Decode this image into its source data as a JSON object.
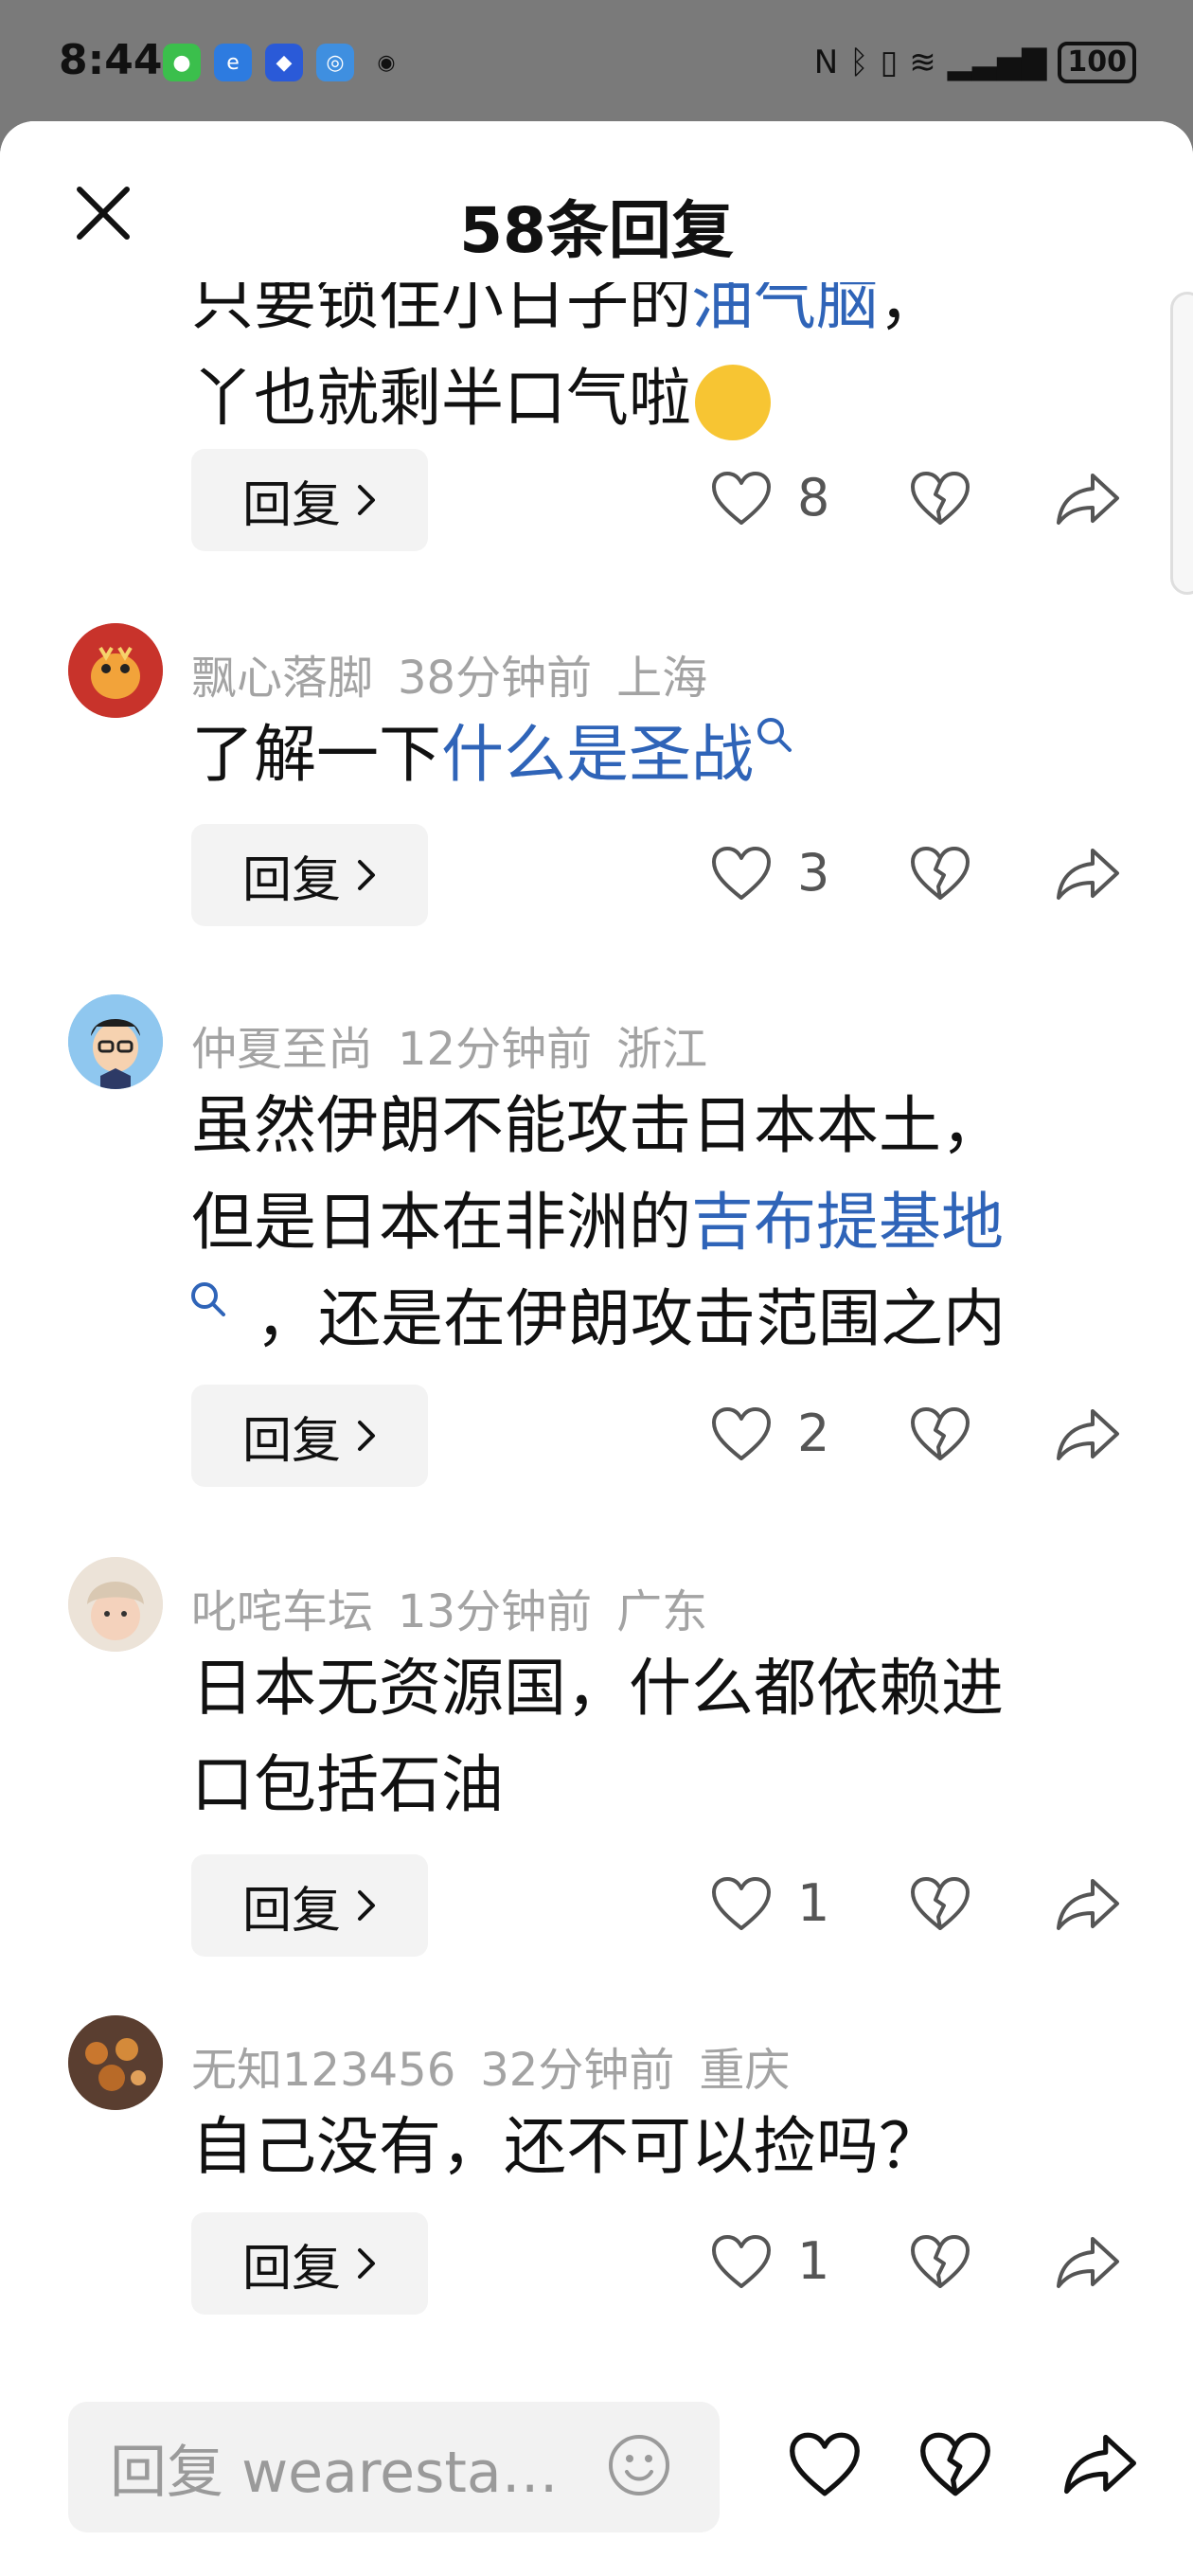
{
  "status": {
    "time": "8:44",
    "battery": "100"
  },
  "sheet": {
    "title": "58条回复"
  },
  "partial_comment": {
    "line1_prefix": "只要锁住小日子的",
    "line1_link": "油气脑",
    "line1_suffix": "，",
    "line2": "丫也就剩半口气啦",
    "reply_label": "回复",
    "likes": "8"
  },
  "comments": [
    {
      "user": "飘心落脚",
      "time": "38分钟前",
      "location": "上海",
      "body_prefix": "了解一下",
      "body_link": "什么是圣战",
      "reply_label": "回复",
      "likes": "3"
    },
    {
      "user": "仲夏至尚",
      "time": "12分钟前",
      "location": "浙江",
      "line1": "虽然伊朗不能攻击日本本土，",
      "line2_prefix": "但是日本在非洲的",
      "line2_link": "吉布提基地",
      "line3": "，还是在伊朗攻击范围之内",
      "reply_label": "回复",
      "likes": "2"
    },
    {
      "user": "叱咤车坛",
      "time": "13分钟前",
      "location": "广东",
      "line1": "日本无资源国，什么都依赖进",
      "line2": "口包括石油",
      "reply_label": "回复",
      "likes": "1"
    },
    {
      "user": "无知123456",
      "time": "32分钟前",
      "location": "重庆",
      "line1": "自己没有，还不可以捡吗？",
      "reply_label": "回复",
      "likes": "1"
    }
  ],
  "bottom": {
    "reply_placeholder": "回复 wearesta…"
  },
  "icons": {
    "close": "close-icon",
    "heart": "heart-icon",
    "broken_heart": "broken-heart-icon",
    "share": "share-icon",
    "emoji": "emoji-icon",
    "search": "search-icon",
    "chevron": "chevron-right-icon"
  },
  "colors": {
    "link": "#2f64b8",
    "meta": "#a3a3a3",
    "reply_bg": "#f3f3f3"
  }
}
